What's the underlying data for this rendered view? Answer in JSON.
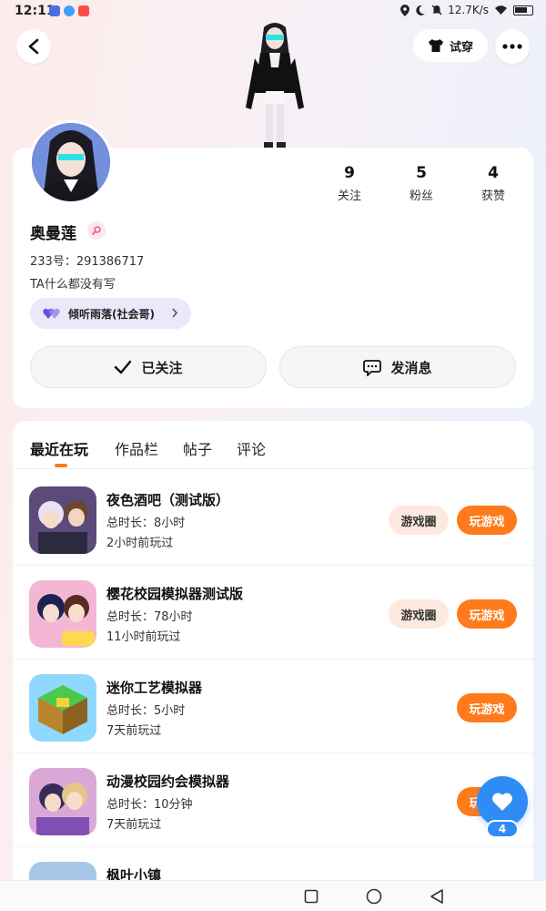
{
  "status_bar": {
    "time": "12:11",
    "network_speed": "12.7K/s",
    "icons": [
      "location-icon",
      "moon-icon",
      "bell-muted-icon",
      "wifi-icon",
      "battery-icon"
    ]
  },
  "header": {
    "back_icon": "back-arrow-icon",
    "try_on_label": "试穿",
    "more_icon": "more-dots-icon"
  },
  "profile": {
    "username": "奥曼莲",
    "user_id": "233号：291386717",
    "bio": "TA什么都没有写",
    "badge_label": "倾听雨落(社会哥)",
    "stats": [
      {
        "value": "9",
        "label": "关注"
      },
      {
        "value": "5",
        "label": "粉丝"
      },
      {
        "value": "4",
        "label": "获赞"
      }
    ],
    "follow_button": "已关注",
    "message_button": "发消息"
  },
  "tabs": [
    {
      "label": "最近在玩",
      "active": true
    },
    {
      "label": "作品栏",
      "active": false
    },
    {
      "label": "帖子",
      "active": false
    },
    {
      "label": "评论",
      "active": false
    }
  ],
  "games": [
    {
      "title": "夜色酒吧（测试版）",
      "duration": "总时长：8小时",
      "last_played": "2小时前玩过",
      "has_circle": true,
      "circle_label": "游戏圈",
      "play_label": "玩游戏"
    },
    {
      "title": "樱花校园模拟器测试版",
      "duration": "总时长：78小时",
      "last_played": "11小时前玩过",
      "has_circle": true,
      "circle_label": "游戏圈",
      "play_label": "玩游戏"
    },
    {
      "title": "迷你工艺模拟器",
      "duration": "总时长：5小时",
      "last_played": "7天前玩过",
      "has_circle": false,
      "play_label": "玩游戏"
    },
    {
      "title": "动漫校园约会模拟器",
      "duration": "总时长：10分钟",
      "last_played": "7天前玩过",
      "has_circle": false,
      "play_label": "玩游戏"
    },
    {
      "title": "枫叶小镇",
      "duration": "",
      "last_played": "",
      "has_circle": true,
      "circle_label": "",
      "play_label": ""
    }
  ],
  "fab": {
    "icon": "heart-icon",
    "count": "4"
  },
  "colors": {
    "accent_orange": "#ff7a1a",
    "accent_blue": "#2f8cf5",
    "badge_bg": "#ece8fb"
  }
}
